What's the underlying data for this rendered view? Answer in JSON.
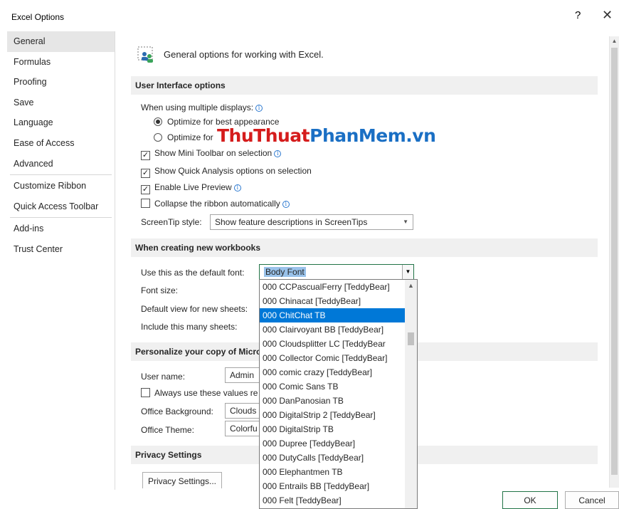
{
  "window": {
    "title": "Excel Options",
    "help": "?",
    "close": "✕"
  },
  "sidebar": {
    "items": [
      {
        "label": "General",
        "selected": true
      },
      {
        "label": "Formulas"
      },
      {
        "label": "Proofing"
      },
      {
        "label": "Save"
      },
      {
        "label": "Language"
      },
      {
        "label": "Ease of Access"
      },
      {
        "label": "Advanced"
      },
      {
        "label": "Customize Ribbon"
      },
      {
        "label": "Quick Access Toolbar"
      },
      {
        "label": "Add-ins"
      },
      {
        "label": "Trust Center"
      }
    ]
  },
  "main": {
    "header": "General options for working with Excel.",
    "ui_section": "User Interface options",
    "multi_display_label": "When using multiple displays:",
    "radio_best": "Optimize for best appearance",
    "radio_compat": "Optimize for",
    "mini_toolbar": "Show Mini Toolbar on selection",
    "quick_analysis": "Show Quick Analysis options on selection",
    "live_preview": "Enable Live Preview",
    "collapse_ribbon": "Collapse the ribbon automatically",
    "screentip_label": "ScreenTip style:",
    "screentip_value": "Show feature descriptions in ScreenTips",
    "new_wb_section": "When creating new workbooks",
    "default_font_label": "Use this as the default font:",
    "default_font_value": "Body Font",
    "font_size_label": "Font size:",
    "default_view_label": "Default view for new sheets:",
    "sheets_label": "Include this many sheets:",
    "personalize_section": "Personalize your copy of Micro",
    "username_label": "User name:",
    "username_value": "Admin",
    "always_use": "Always use these values re",
    "office_bg_label": "Office Background:",
    "office_bg_value": "Clouds",
    "office_theme_label": "Office Theme:",
    "office_theme_value": "Colorfu",
    "privacy_section": "Privacy Settings",
    "privacy_button": "Privacy Settings..."
  },
  "font_list": {
    "items": [
      "000 CCPascualFerry [TeddyBear]",
      "000 Chinacat [TeddyBear]",
      "000 ChitChat TB",
      "000 Clairvoyant BB [TeddyBear]",
      "000 Cloudsplitter LC [TeddyBear",
      "000 Collector Comic [TeddyBear]",
      "000 comic crazy [TeddyBear]",
      "000 Comic Sans TB",
      "000 DanPanosian TB",
      "000 DigitalStrip 2 [TeddyBear]",
      "000 DigitalStrip TB",
      "000 Dupree [TeddyBear]",
      "000 DutyCalls [TeddyBear]",
      "000 Elephantmen TB",
      "000 Entrails BB [TeddyBear]",
      "000 Felt [TeddyBear]"
    ],
    "highlighted": "000 ChitChat TB"
  },
  "footer": {
    "ok": "OK",
    "cancel": "Cancel"
  },
  "watermark": {
    "part1": "ThuThuat",
    "part2": "PhanMem.vn"
  }
}
